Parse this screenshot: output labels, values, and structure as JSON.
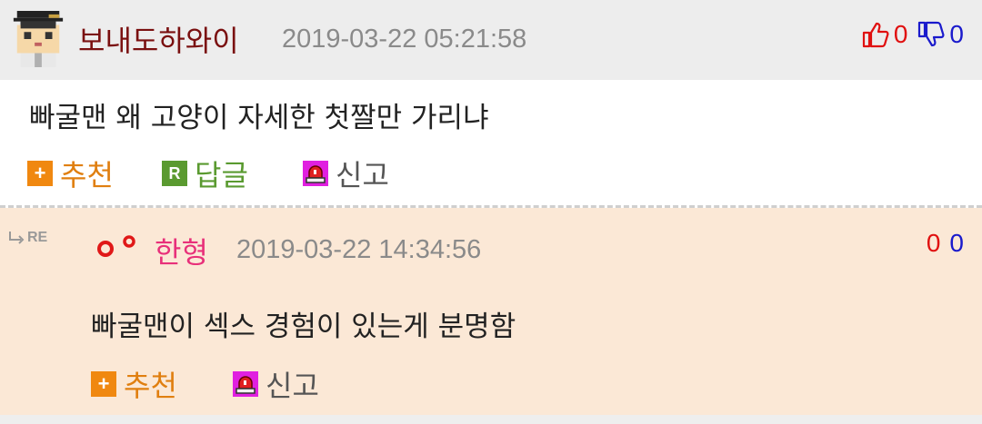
{
  "comment": {
    "author": "보내도하와이",
    "timestamp": "2019-03-22 05:21:58",
    "upvotes": "0",
    "downvotes": "0",
    "text": "빠굴맨 왜 고양이 자세한 첫짤만 가리냐",
    "actions": {
      "recommend": "추천",
      "reply": "답글",
      "report": "신고"
    }
  },
  "reply": {
    "re_label": "RE",
    "author": "한형",
    "timestamp": "2019-03-22 14:34:56",
    "upvotes": "0",
    "downvotes": "0",
    "text": "빠굴맨이 섹스 경험이 있는게 분명함",
    "actions": {
      "recommend": "추천",
      "report": "신고"
    }
  },
  "colors": {
    "author": "#7a1010",
    "reply_author": "#e8307a",
    "upvote": "#e01010",
    "downvote": "#1a1acc",
    "reply_bg": "#fbe8d6"
  },
  "icons": [
    "avatar-pixel-graduate",
    "thumbs-up-icon",
    "thumbs-down-icon",
    "plus-icon",
    "reply-r-icon",
    "siren-icon",
    "level-icon",
    "reply-arrow-icon"
  ]
}
